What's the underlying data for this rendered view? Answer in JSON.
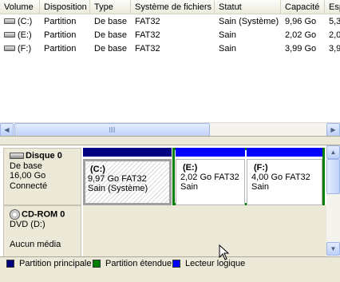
{
  "list": {
    "columns": [
      "Volume",
      "Disposition",
      "Type",
      "Système de fichiers",
      "Statut",
      "Capacité",
      "Esp"
    ],
    "rows": [
      {
        "volume": "(C:)",
        "disposition": "Partition",
        "type": "De base",
        "fs": "FAT32",
        "status": "Sain (Système)",
        "capacity": "9,96 Go",
        "free": "5,3"
      },
      {
        "volume": "(E:)",
        "disposition": "Partition",
        "type": "De base",
        "fs": "FAT32",
        "status": "Sain",
        "capacity": "2,02 Go",
        "free": "2,0"
      },
      {
        "volume": "(F:)",
        "disposition": "Partition",
        "type": "De base",
        "fs": "FAT32",
        "status": "Sain",
        "capacity": "3,99 Go",
        "free": "3,9"
      }
    ]
  },
  "disk0": {
    "name": "Disque 0",
    "type": "De base",
    "size": "16,00 Go",
    "state": "Connecté",
    "partitions": [
      {
        "letter": "(C:)",
        "size": "9,97 Go FAT32",
        "status": "Sain (Système)"
      },
      {
        "letter": "(E:)",
        "size": "2,02 Go FAT32",
        "status": "Sain"
      },
      {
        "letter": "(F:)",
        "size": "4,00 Go FAT32",
        "status": "Sain"
      }
    ]
  },
  "cdrom": {
    "name": "CD-ROM 0",
    "drive": "DVD (D:)",
    "media": "Aucun média"
  },
  "legend": {
    "primary": "Partition principale",
    "extended": "Partition étendue",
    "logical": "Lecteur logique",
    "colors": {
      "primary": "#000080",
      "extended": "#008000",
      "logical": "#0000ff"
    }
  },
  "icons": {
    "volume": "drive-icon",
    "disk": "hard-disk-icon",
    "cdrom": "cdrom-icon",
    "cursor": "mouse-pointer-icon"
  }
}
